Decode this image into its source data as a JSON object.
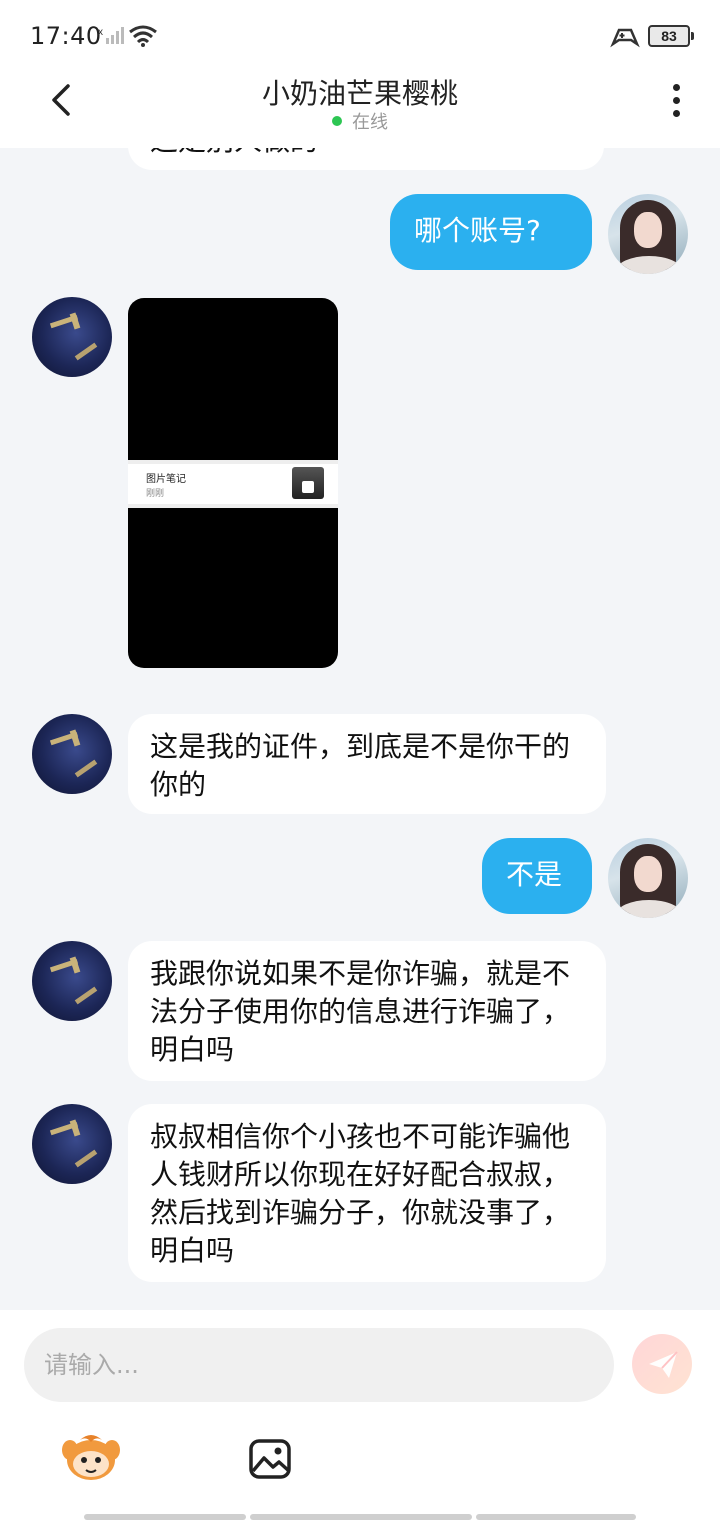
{
  "status": {
    "time": "17:40",
    "battery": "83"
  },
  "header": {
    "title": "小奶油芒果樱桃",
    "status": "在线"
  },
  "messages": {
    "m0_partial": "这是别人做的",
    "m1": "哪个账号?",
    "shared_note": {
      "title": "图片笔记",
      "sub": "刚刚"
    },
    "m3": "这是我的证件，到底是不是你干的你的",
    "m4": "不是",
    "m5": "我跟你说如果不是你诈骗，就是不法分子使用你的信息进行诈骗了，明白吗",
    "m6": "叔叔相信你个小孩也不可能诈骗他人钱财所以你现在好好配合叔叔，然后找到诈骗分子，你就没事了，明白吗"
  },
  "input": {
    "placeholder": "请输入...",
    "value": ""
  },
  "colors": {
    "accent": "#2bb0ef",
    "online": "#2dc653",
    "bg": "#f3f5f8"
  }
}
